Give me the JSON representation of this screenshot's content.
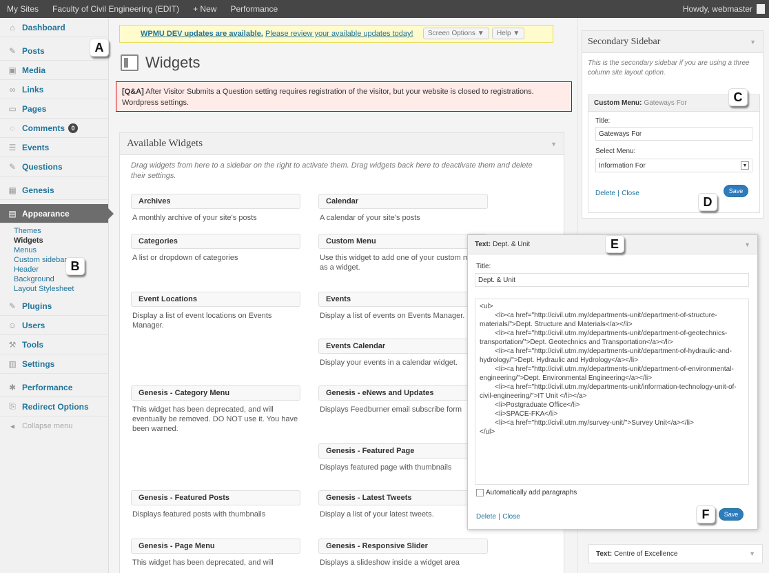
{
  "adminbar": {
    "items": [
      "My Sites",
      "Faculty of Civil Engineering (EDIT)",
      "+ New",
      "Performance"
    ],
    "howdy": "Howdy, webmaster"
  },
  "menu": {
    "items": [
      {
        "label": "Dashboard",
        "icon": "dashboard-icon"
      },
      {
        "label": "Posts",
        "icon": "posts-icon"
      },
      {
        "label": "Media",
        "icon": "media-icon"
      },
      {
        "label": "Links",
        "icon": "links-icon"
      },
      {
        "label": "Pages",
        "icon": "pages-icon"
      },
      {
        "label": "Comments",
        "icon": "comments-icon",
        "badge": "0"
      },
      {
        "label": "Events",
        "icon": "events-icon"
      },
      {
        "label": "Questions",
        "icon": "questions-icon"
      },
      {
        "label": "Genesis",
        "icon": "genesis-icon"
      },
      {
        "label": "Appearance",
        "icon": "appearance-icon"
      },
      {
        "label": "Plugins",
        "icon": "plugins-icon"
      },
      {
        "label": "Users",
        "icon": "users-icon"
      },
      {
        "label": "Tools",
        "icon": "tools-icon"
      },
      {
        "label": "Settings",
        "icon": "settings-icon"
      },
      {
        "label": "Performance",
        "icon": "performance-icon"
      },
      {
        "label": "Redirect Options",
        "icon": "redirect-icon"
      },
      {
        "label": "Collapse menu",
        "icon": "collapse-icon"
      }
    ],
    "submenu": [
      "Themes",
      "Widgets",
      "Menus",
      "Custom sidebars",
      "Header",
      "Background",
      "Layout Stylesheet"
    ]
  },
  "notice": {
    "strong": "WPMU DEV updates are available.",
    "link": "Please review your available updates today!",
    "screen_options": "Screen Options ▼",
    "help": "Help ▼"
  },
  "page_title": "Widgets",
  "error": {
    "strong": "[Q&A]",
    "text": "After Visitor Submits a Question setting requires registration of the visitor, but your website is closed to registrations. Wordpress settings."
  },
  "available": {
    "title": "Available Widgets",
    "desc": "Drag widgets from here to a sidebar on the right to activate them. Drag widgets back here to deactivate them and delete their settings.",
    "widgets": [
      {
        "title": "Archives",
        "desc": "A monthly archive of your site's posts"
      },
      {
        "title": "Calendar",
        "desc": "A calendar of your site's posts"
      },
      {
        "title": "Categories",
        "desc": "A list or dropdown of categories"
      },
      {
        "title": "Custom Menu",
        "desc": "Use this widget to add one of your custom menus as a widget."
      },
      {
        "title": "Event Locations",
        "desc": "Display a list of event locations on Events Manager."
      },
      {
        "title": "Events",
        "desc": "Display a list of events on Events Manager."
      },
      {
        "title": "Events Calendar",
        "desc": "Display your events in a calendar widget."
      },
      {
        "title": "Genesis - Category Menu",
        "desc": "This widget has been deprecated, and will eventually be removed. DO NOT use it. You have been warned."
      },
      {
        "title": "Genesis - eNews and Updates",
        "desc": "Displays Feedburner email subscribe form"
      },
      {
        "title": "Genesis - Featured Page",
        "desc": "Displays featured page with thumbnails"
      },
      {
        "title": "Genesis - Featured Posts",
        "desc": "Displays featured posts with thumbnails"
      },
      {
        "title": "Genesis - Latest Tweets",
        "desc": "Display a list of your latest tweets."
      },
      {
        "title": "Genesis - Page Menu",
        "desc": "This widget has been deprecated, and will"
      },
      {
        "title": "Genesis - Responsive Slider",
        "desc": "Displays a slideshow inside a widget area"
      }
    ]
  },
  "sidebar": {
    "title": "Secondary Sidebar",
    "desc": "This is the secondary sidebar if you are using a three column site layout option.",
    "custom_menu": {
      "type": "Custom Menu:",
      "name": "Gateways For",
      "title_label": "Title:",
      "title_value": "Gateways For",
      "select_label": "Select Menu:",
      "select_value": "Information For",
      "delete": "Delete",
      "close": "Close",
      "save": "Save"
    },
    "coe": {
      "type": "Text:",
      "name": "Centre of Excellence"
    }
  },
  "text_widget": {
    "type": "Text:",
    "name": "Dept. & Unit",
    "title_label": "Title:",
    "title_value": "Dept. & Unit",
    "content": "<ul>\n        <li><a href=\"http://civil.utm.my/departments-unit/department-of-structure-materials/\">Dept. Structure and Materials</a></li>\n        <li><a href=\"http://civil.utm.my/departments-unit/department-of-geotechnics-transportation/\">Dept. Geotechnics and Transportation</a></li>\n        <li><a href=\"http://civil.utm.my/departments-unit/department-of-hydraulic-and-hydrology/\">Dept. Hydraulic and Hydrology</a></li>\n        <li><a href=\"http://civil.utm.my/departments-unit/department-of-environmental-engineering/\">Dept. Environmental Engineering</a></li>\n        <li><a href=\"http://civil.utm.my/departments-unit/information-technology-unit-of-civil-engineering/\">IT Unit </li></a>\n        <li>Postgraduate Office</li>\n        <li>SPACE-FKA</li>\n        <li><a href=\"http://civil.utm.my/survey-unit/\">Survey Unit</a></li>\n</ul>",
    "auto_p": "Automatically add paragraphs",
    "delete": "Delete",
    "close": "Close",
    "save": "Save"
  },
  "callouts": [
    "A",
    "B",
    "C",
    "D",
    "E",
    "F"
  ]
}
